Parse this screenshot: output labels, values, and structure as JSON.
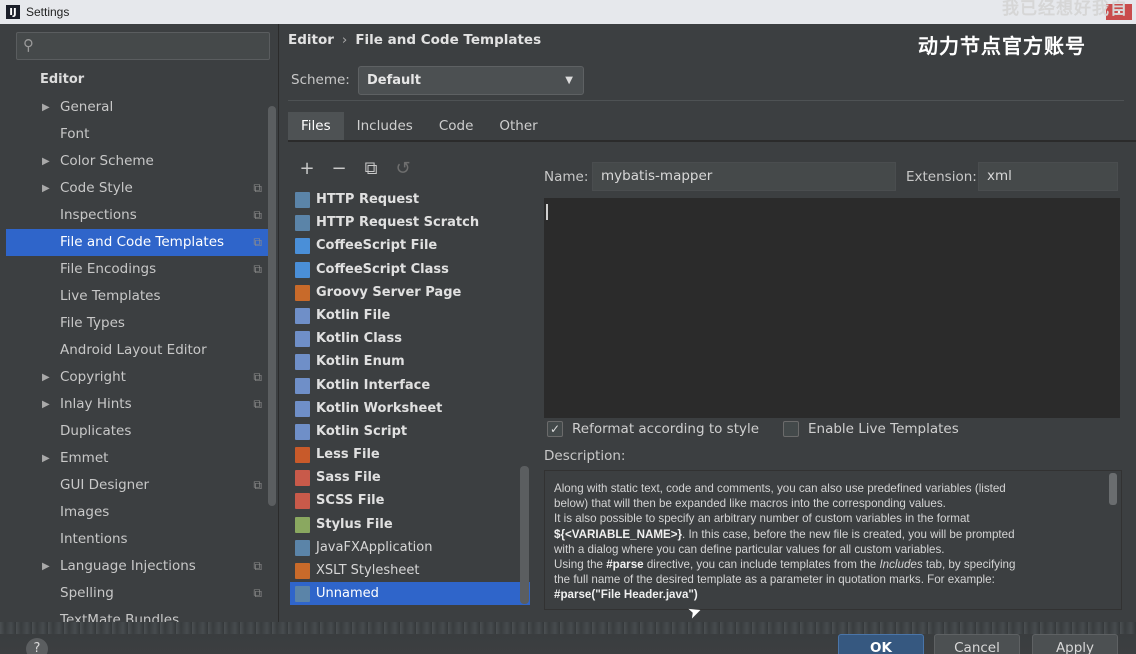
{
  "window": {
    "title": "Settings",
    "app_icon": "intellij-icon",
    "close_label": "x"
  },
  "overlay": {
    "top_right": "我已经想好我自",
    "brand": "动力节点官方账号"
  },
  "left": {
    "search": {
      "value": "",
      "icon": "search-icon"
    },
    "heading": "Editor",
    "items": [
      {
        "label": "General",
        "arrow": true,
        "copy": false
      },
      {
        "label": "Font",
        "arrow": false,
        "copy": false
      },
      {
        "label": "Color Scheme",
        "arrow": true,
        "copy": false
      },
      {
        "label": "Code Style",
        "arrow": true,
        "copy": true
      },
      {
        "label": "Inspections",
        "arrow": false,
        "copy": true
      },
      {
        "label": "File and Code Templates",
        "arrow": false,
        "copy": true,
        "selected": true
      },
      {
        "label": "File Encodings",
        "arrow": false,
        "copy": true
      },
      {
        "label": "Live Templates",
        "arrow": false,
        "copy": false
      },
      {
        "label": "File Types",
        "arrow": false,
        "copy": false
      },
      {
        "label": "Android Layout Editor",
        "arrow": false,
        "copy": false
      },
      {
        "label": "Copyright",
        "arrow": true,
        "copy": true
      },
      {
        "label": "Inlay Hints",
        "arrow": true,
        "copy": true
      },
      {
        "label": "Duplicates",
        "arrow": false,
        "copy": false
      },
      {
        "label": "Emmet",
        "arrow": true,
        "copy": false
      },
      {
        "label": "GUI Designer",
        "arrow": false,
        "copy": true
      },
      {
        "label": "Images",
        "arrow": false,
        "copy": false
      },
      {
        "label": "Intentions",
        "arrow": false,
        "copy": false
      },
      {
        "label": "Language Injections",
        "arrow": true,
        "copy": true
      },
      {
        "label": "Spelling",
        "arrow": false,
        "copy": true
      },
      {
        "label": "TextMate Bundles",
        "arrow": false,
        "copy": false
      }
    ]
  },
  "breadcrumb": {
    "parent": "Editor",
    "separator": "›",
    "current": "File and Code Templates"
  },
  "scheme": {
    "label": "Scheme:",
    "value": "Default"
  },
  "tabs": [
    {
      "label": "Files",
      "active": true
    },
    {
      "label": "Includes",
      "active": false
    },
    {
      "label": "Code",
      "active": false
    },
    {
      "label": "Other",
      "active": false
    }
  ],
  "toolbar": {
    "add": "+",
    "remove": "−",
    "copy": "⧉",
    "reset": "↺"
  },
  "templates": [
    {
      "label": "HTTP Request",
      "color": "#5b84a8",
      "bold": true
    },
    {
      "label": "HTTP Request Scratch",
      "color": "#5b84a8",
      "bold": true
    },
    {
      "label": "CoffeeScript File",
      "color": "#4a8fd8",
      "bold": true
    },
    {
      "label": "CoffeeScript Class",
      "color": "#4a8fd8",
      "bold": true
    },
    {
      "label": "Groovy Server Page",
      "color": "#c86a2a",
      "bold": true
    },
    {
      "label": "Kotlin File",
      "color": "#6f8fc8",
      "bold": true
    },
    {
      "label": "Kotlin Class",
      "color": "#6f8fc8",
      "bold": true
    },
    {
      "label": "Kotlin Enum",
      "color": "#6f8fc8",
      "bold": true
    },
    {
      "label": "Kotlin Interface",
      "color": "#6f8fc8",
      "bold": true
    },
    {
      "label": "Kotlin Worksheet",
      "color": "#6f8fc8",
      "bold": true
    },
    {
      "label": "Kotlin Script",
      "color": "#6f8fc8",
      "bold": true
    },
    {
      "label": "Less File",
      "color": "#c85a2a",
      "bold": true
    },
    {
      "label": "Sass File",
      "color": "#c85a4a",
      "bold": true
    },
    {
      "label": "SCSS File",
      "color": "#c85a4a",
      "bold": true
    },
    {
      "label": "Stylus File",
      "color": "#8aa860",
      "bold": true
    },
    {
      "label": "JavaFXApplication",
      "color": "#5b84a8",
      "bold": false
    },
    {
      "label": "XSLT Stylesheet",
      "color": "#c86a2a",
      "bold": false
    },
    {
      "label": "Unnamed",
      "color": "#5b84a8",
      "bold": false,
      "selected": true
    }
  ],
  "form": {
    "name_label": "Name:",
    "name_value": "mybatis-mapper",
    "ext_label": "Extension:",
    "ext_value": "xml"
  },
  "options": {
    "reformat": {
      "label": "Reformat according to style",
      "checked": true
    },
    "live_templates": {
      "label": "Enable Live Templates",
      "checked": false
    }
  },
  "description": {
    "label": "Description:",
    "line1": "Along with static text, code and comments, you can also use predefined variables (listed",
    "line2": "below) that will then be expanded like macros into the corresponding values.",
    "line3a": "It is also possible to specify an arbitrary number of custom variables in the format",
    "line3b": "${<VARIABLE_NAME>}",
    "line3c": ". In this case, before the new file is created, you will be prompted",
    "line4": "with a dialog where you can define particular values for all custom variables.",
    "line5a": "Using the ",
    "line5b": "#parse",
    "line5c": " directive, you can include templates from the ",
    "line5d": "Includes",
    "line5e": " tab, by specifying",
    "line6": "the full name of the desired template as a parameter in quotation marks. For example:",
    "line7": "#parse(\"File Header.java\")"
  },
  "buttons": {
    "help": "?",
    "ok": "OK",
    "cancel": "Cancel",
    "apply": "Apply"
  }
}
